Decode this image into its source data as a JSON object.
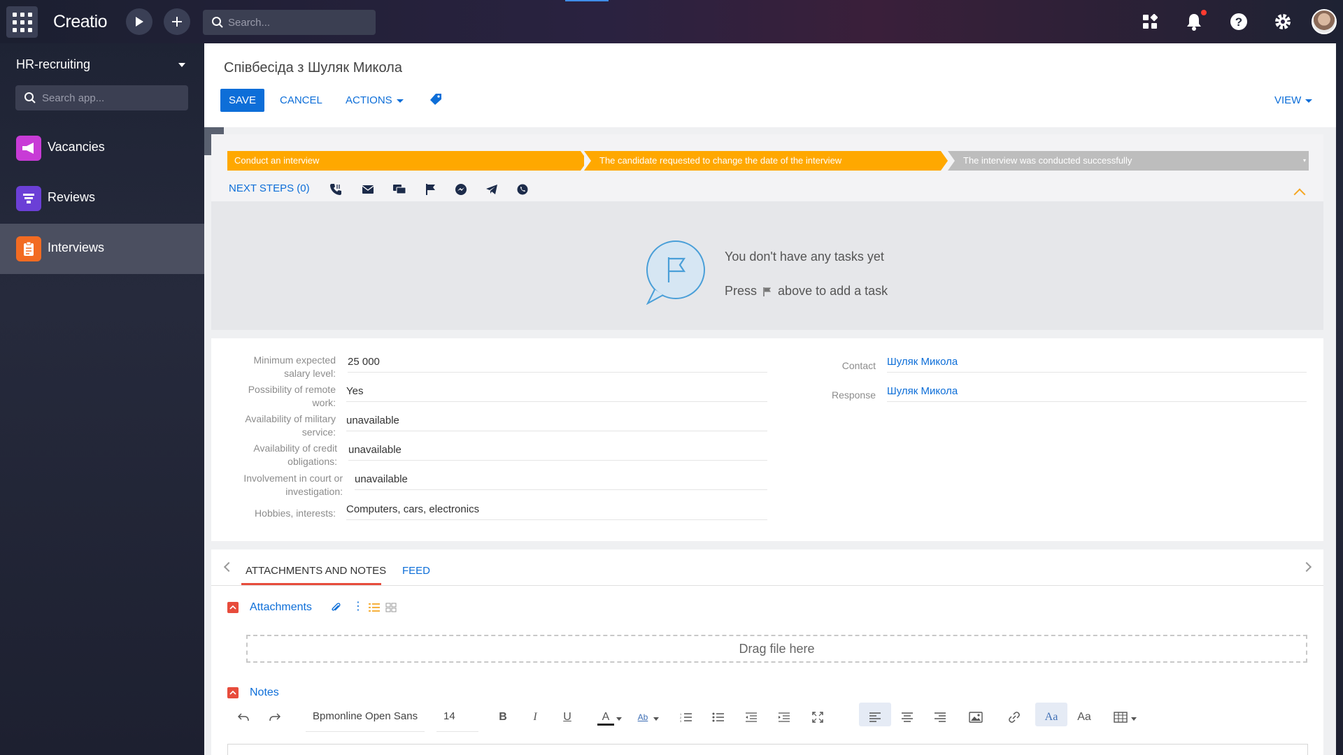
{
  "topbar": {
    "logo": "Creatio",
    "search_placeholder": "Search..."
  },
  "sidebar": {
    "title": "HR-recruiting",
    "search_placeholder": "Search app...",
    "items": [
      {
        "label": "Vacancies",
        "color": "#c83bd6"
      },
      {
        "label": "Reviews",
        "color": "#6b3fd6"
      },
      {
        "label": "Interviews",
        "color": "#f26b22"
      }
    ]
  },
  "header": {
    "title": "Співбесіда з Шуляк Микола",
    "save": "SAVE",
    "cancel": "CANCEL",
    "actions": "ACTIONS",
    "view": "VIEW"
  },
  "stages": [
    {
      "label": "Conduct an interview",
      "color": "#ffa800"
    },
    {
      "label": "The candidate requested to change the date of the interview",
      "color": "#ffa800"
    },
    {
      "label": "The interview was conducted successfully",
      "color": "#bdbdbd"
    }
  ],
  "next_steps": {
    "label": "NEXT STEPS (0)",
    "empty_line1": "You don't have any tasks yet",
    "empty_line2_pre": "Press",
    "empty_line2_post": "above to add a task"
  },
  "fields_left": [
    {
      "label": "Minimum expected salary level:",
      "value": "25 000"
    },
    {
      "label": "Possibility of remote work:",
      "value": "Yes"
    },
    {
      "label": "Availability of military service:",
      "value": "unavailable"
    },
    {
      "label": "Availability of credit obligations:",
      "value": "unavailable"
    },
    {
      "label": "Involvement in court or investigation:",
      "value": "unavailable"
    },
    {
      "label": "Hobbies, interests:",
      "value": "Computers, cars, electronics"
    }
  ],
  "fields_right": [
    {
      "label": "Contact",
      "value": "Шуляк Микола"
    },
    {
      "label": "Response",
      "value": "Шуляк Микола"
    }
  ],
  "tabs": {
    "active": "ATTACHMENTS AND NOTES",
    "other": "FEED"
  },
  "attachments": {
    "title": "Attachments",
    "dropzone": "Drag file here"
  },
  "notes": {
    "title": "Notes",
    "font": "Bpmonline Open Sans",
    "size": "14",
    "bold": "B",
    "italic": "I",
    "underline": "U",
    "font_color": "A",
    "highlight": "Ab",
    "case_a": "Aa",
    "case_b": "Aa"
  },
  "colors": {
    "accent": "#0d6ed8",
    "stage_active": "#ffa800",
    "stage_inactive": "#bdbdbd",
    "section_toggle": "#e74c3c"
  }
}
